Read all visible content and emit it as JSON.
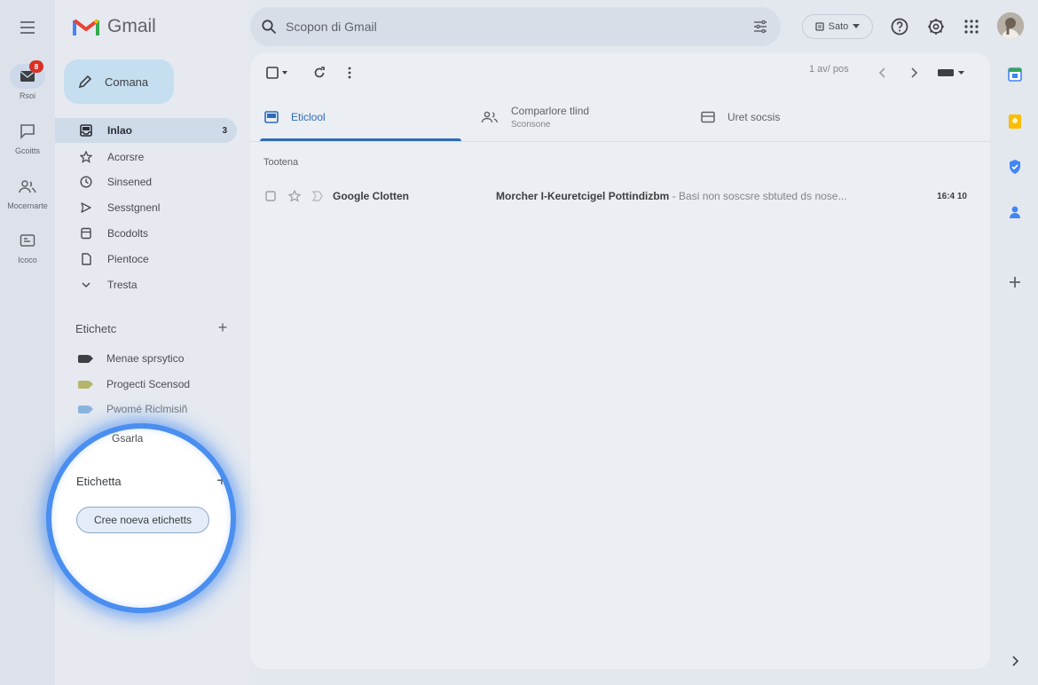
{
  "app": {
    "name": "Gmail"
  },
  "search": {
    "placeholder": "Scopon di Gmail"
  },
  "header": {
    "status_label": "Sato"
  },
  "rail": [
    {
      "label": "Rsoi",
      "badge": "8"
    },
    {
      "label": "Gcoitts"
    },
    {
      "label": "Mocernarte"
    },
    {
      "label": "Icoco"
    }
  ],
  "compose": {
    "label": "Comana"
  },
  "nav": [
    {
      "label": "Inlao",
      "count": "3"
    },
    {
      "label": "Acorsre"
    },
    {
      "label": "Sinsened"
    },
    {
      "label": "Sesstgnenl"
    },
    {
      "label": "Bcodolts"
    },
    {
      "label": "Pientoce"
    },
    {
      "label": "Tresta"
    }
  ],
  "labels_section": {
    "title": "Etichetc",
    "items": [
      {
        "label": "Menae sprsytico",
        "color": "#3c4043"
      },
      {
        "label": "Progecti Scensod",
        "color": "#b5b56a"
      },
      {
        "label": "Pwomé Riclmisiñ",
        "color": "#6fa3d8"
      },
      {
        "label": "Gsarla"
      }
    ]
  },
  "magnifier": {
    "section_title": "Etichetta",
    "button_label": "Cree noeva etichetts"
  },
  "toolbar": {
    "pager": "1 av/ pos"
  },
  "tabs": [
    {
      "title": "Eticlool"
    },
    {
      "title": "Comparlore tlind",
      "subtitle": "Sconsone"
    },
    {
      "title": "Uret socsis"
    }
  ],
  "inbox": {
    "section": "Tootena",
    "rows": [
      {
        "sender": "Google Clotten",
        "subject": "Morcher I-Keuretcigel Pottindizbm",
        "snippet": " - Basi non soscsre sbtuted ds nose...",
        "time": "16:4 10"
      }
    ]
  },
  "colors": {
    "accent": "#2f6bb8",
    "magnifier_ring": "#4a8ef0",
    "badge": "#d93025"
  }
}
